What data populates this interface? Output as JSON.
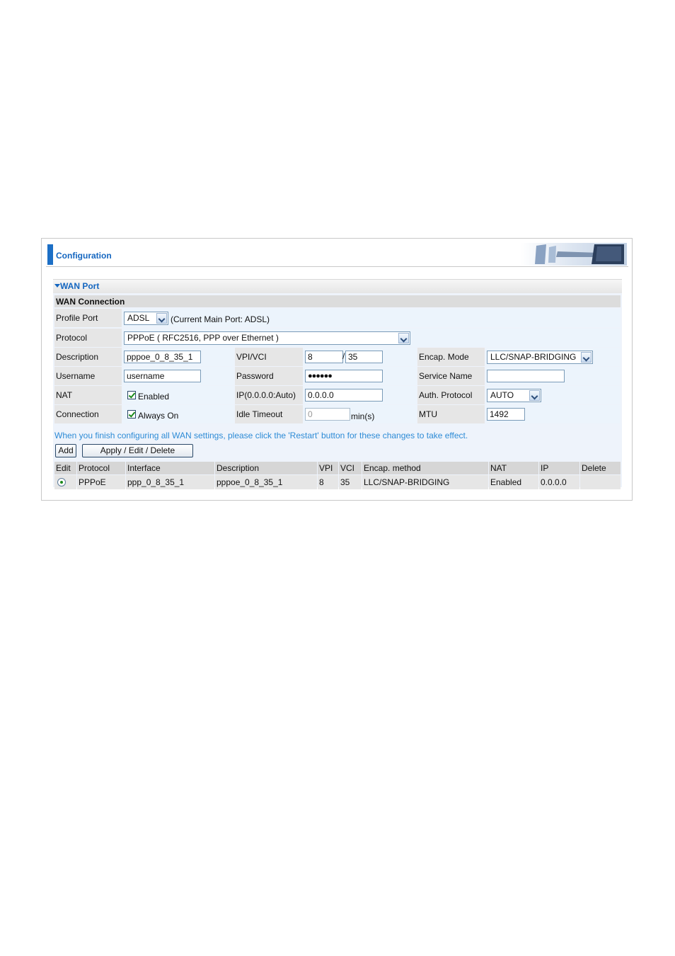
{
  "header": {
    "title": "Configuration"
  },
  "wan_port": {
    "title": "WAN Port",
    "section_title": "WAN Connection"
  },
  "form": {
    "profile_port": {
      "label": "Profile Port",
      "value": "ADSL",
      "hint": "(Current Main Port: ADSL)"
    },
    "protocol": {
      "label": "Protocol",
      "value": "PPPoE ( RFC2516, PPP over Ethernet )"
    },
    "description": {
      "label": "Description",
      "value": "pppoe_0_8_35_1"
    },
    "vpi_vci": {
      "label": "VPI/VCI",
      "vpi": "8",
      "separator": "/",
      "vci": "35"
    },
    "encap_mode": {
      "label": "Encap. Mode",
      "value": "LLC/SNAP-BRIDGING"
    },
    "username": {
      "label": "Username",
      "value": "username"
    },
    "password": {
      "label": "Password",
      "value": "●●●●●●"
    },
    "service_name": {
      "label": "Service Name",
      "value": ""
    },
    "nat": {
      "label": "NAT",
      "checkbox_label": "Enabled",
      "checked": true
    },
    "ip": {
      "label": "IP(0.0.0.0:Auto)",
      "value": "0.0.0.0"
    },
    "auth_protocol": {
      "label": "Auth. Protocol",
      "value": "AUTO"
    },
    "connection": {
      "label": "Connection",
      "checkbox_label": "Always On",
      "checked": true
    },
    "idle_timeout": {
      "label": "Idle Timeout",
      "value": "0",
      "unit": "min(s)"
    },
    "mtu": {
      "label": "MTU",
      "value": "1492"
    }
  },
  "note": "When you finish configuring all WAN settings, please click the 'Restart' button for these changes to take effect.",
  "buttons": {
    "add": "Add",
    "apply": "Apply / Edit / Delete"
  },
  "table": {
    "headers": [
      "Edit",
      "Protocol",
      "Interface",
      "Description",
      "VPI",
      "VCI",
      "Encap. method",
      "NAT",
      "IP",
      "Delete"
    ],
    "rows": [
      {
        "protocol": "PPPoE",
        "interface": "ppp_0_8_35_1",
        "description": "pppoe_0_8_35_1",
        "vpi": "8",
        "vci": "35",
        "encap": "LLC/SNAP-BRIDGING",
        "nat": "Enabled",
        "ip": "0.0.0.0",
        "delete": ""
      }
    ]
  },
  "colors": {
    "accent": "#1466c0",
    "note": "#2d8bd6",
    "section_bg": "#eef3fb"
  },
  "icons": [
    "collapse-triangle-icon",
    "dropdown-arrow-icon",
    "checkbox-checked-icon",
    "radio-selected-icon",
    "office-banner-image"
  ]
}
